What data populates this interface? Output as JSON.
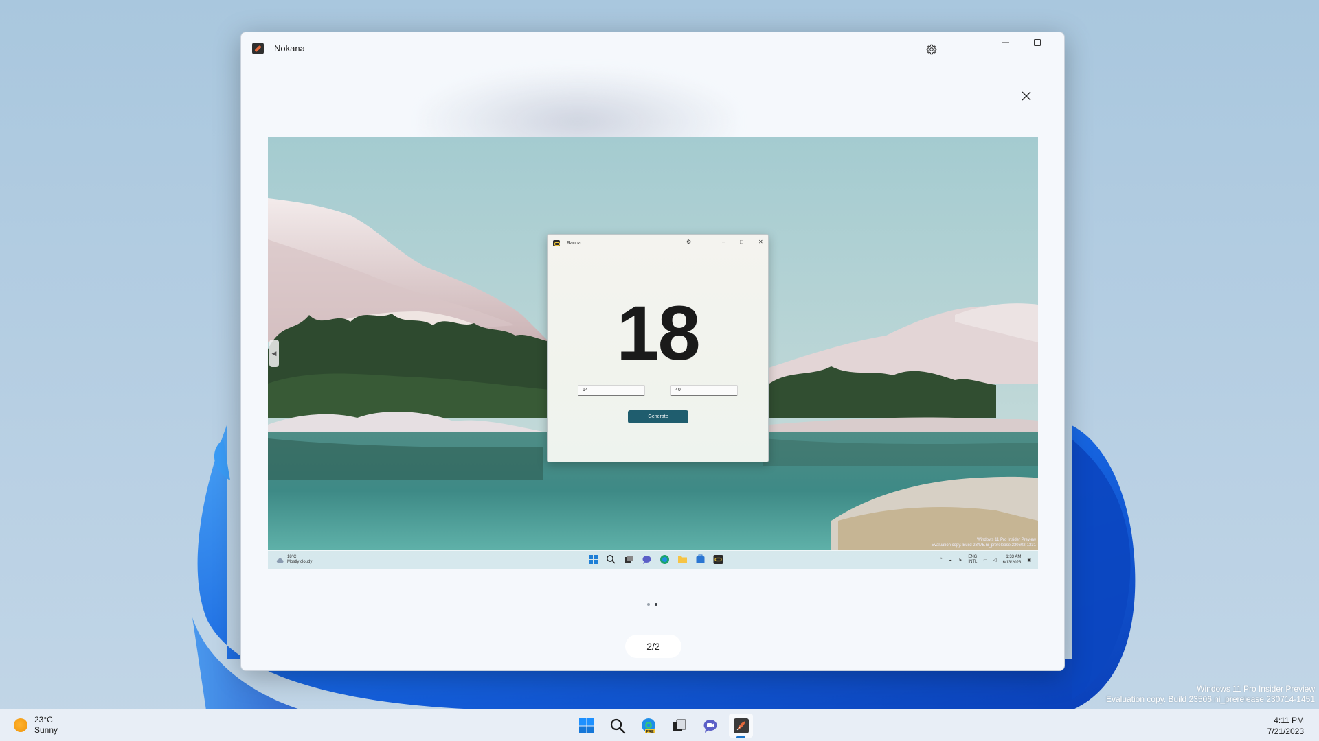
{
  "desktop": {
    "watermark_line1": "Windows 11 Pro Insider Preview",
    "watermark_line2": "Evaluation copy. Build 23506.ni_prerelease.230714-1451"
  },
  "window": {
    "title": "Nokana",
    "icon": "feather-app-icon",
    "controls": [
      "settings-icon",
      "minimize-icon",
      "maximize-icon",
      "close-icon"
    ]
  },
  "viewer": {
    "page_counter": "2/2",
    "page_dots": 2,
    "current_page": 2,
    "prev_icon": "chevron-left-icon",
    "close_icon": "close-icon"
  },
  "screenshot": {
    "inner_window": {
      "title": "Ranna",
      "number": "18",
      "min_value": "14",
      "max_value": "40",
      "generate_label": "Generate"
    },
    "inner_taskbar": {
      "weather_temp": "18°C",
      "weather_desc": "Mostly cloudy",
      "lang1": "ENG",
      "lang2": "INTL",
      "time": "1:33 AM",
      "date": "6/13/2023"
    },
    "watermark_line1": "Windows 11 Pro Insider Preview",
    "watermark_line2": "Evaluation copy. Build 23475.ni_prerelease.230602-1331"
  },
  "taskbar": {
    "weather_temp": "23°C",
    "weather_desc": "Sunny",
    "time": "4:11 PM",
    "date": "7/21/2023",
    "apps": [
      "windows-start-icon",
      "search-icon",
      "edge-preview-icon",
      "task-view-icon",
      "teams-chat-icon",
      "nokana-app-icon"
    ],
    "accent": "#1a73c8"
  }
}
